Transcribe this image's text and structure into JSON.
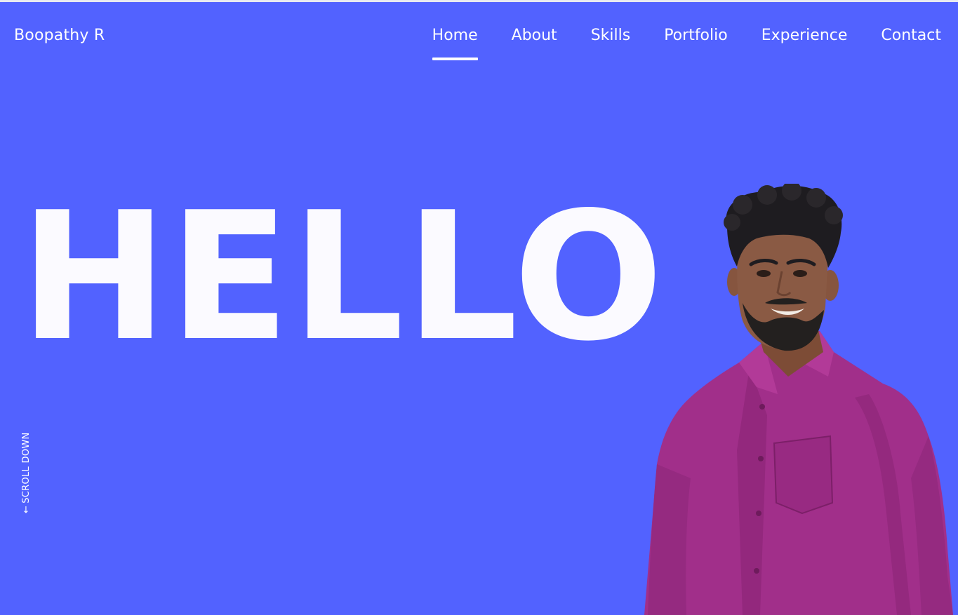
{
  "header": {
    "brand": "Boopathy R",
    "nav": [
      {
        "label": "Home",
        "active": true
      },
      {
        "label": "About",
        "active": false
      },
      {
        "label": "Skills",
        "active": false
      },
      {
        "label": "Portfolio",
        "active": false
      },
      {
        "label": "Experience",
        "active": false
      },
      {
        "label": "Contact",
        "active": false
      }
    ]
  },
  "hero": {
    "headline": "HELLO",
    "scroll_label": "SCROLL DOWN",
    "scroll_icon": "arrow-down-icon",
    "portrait_icon": "portrait-photo"
  },
  "colors": {
    "background": "#5262ff",
    "text": "#ffffff",
    "shirt": "#a12f8a",
    "hair": "#1e1c20",
    "skin": "#8a5a44"
  }
}
